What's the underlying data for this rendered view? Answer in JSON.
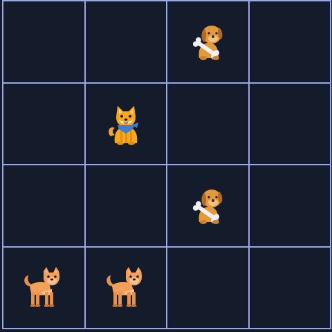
{
  "board": {
    "rows": 4,
    "cols": 4,
    "colors": {
      "background": "#141b2b",
      "grid_line": "#9aa7e8"
    },
    "cells": [
      [
        "",
        "",
        "dog-with-bone",
        ""
      ],
      [
        "",
        "shiba-with-bandana",
        "",
        ""
      ],
      [
        "",
        "",
        "dog-with-bone",
        ""
      ],
      [
        "standing-dog",
        "standing-dog",
        "",
        ""
      ]
    ]
  }
}
